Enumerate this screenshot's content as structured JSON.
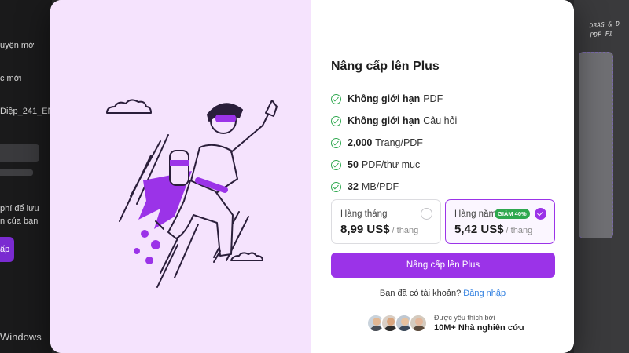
{
  "background": {
    "sidebar": {
      "row1": "uyện mới",
      "row2": "c mới",
      "row3": "Diệp_241_EN...",
      "text1": "phí để lưu",
      "text2": "n của bạn",
      "cta": "ấp",
      "footer": "Windows"
    },
    "dropzone_hint_line1": "DRAG & D",
    "dropzone_hint_line2": "PDF FI"
  },
  "modal": {
    "title": "Nâng cấp lên Plus",
    "features": [
      {
        "bold": "Không giới hạn",
        "rest": "PDF"
      },
      {
        "bold": "Không giới hạn",
        "rest": "Câu hỏi"
      },
      {
        "bold": "2,000",
        "rest": "Trang/PDF"
      },
      {
        "bold": "50",
        "rest": "PDF/thư mục"
      },
      {
        "bold": "32",
        "rest": "MB/PDF"
      }
    ],
    "plans": {
      "monthly": {
        "name": "Hàng tháng",
        "price": "8,99 US$",
        "period": "/ tháng",
        "selected": false
      },
      "annual": {
        "name": "Hàng năm",
        "badge": "GIẢM 40%",
        "price": "5,42 US$",
        "period": "/ tháng",
        "selected": true
      }
    },
    "upgrade_button": "Nâng cấp lên Plus",
    "login_prompt": "Bạn đã có tài khoản?",
    "login_link": "Đăng nhập",
    "social_small": "Được yêu thích bởi",
    "social_big": "10M+ Nhà nghiên cứu"
  },
  "colors": {
    "accent": "#9b33e8",
    "success": "#2fa84f",
    "link": "#2f7fe0",
    "illustration_bg": "#f5e3fd"
  }
}
